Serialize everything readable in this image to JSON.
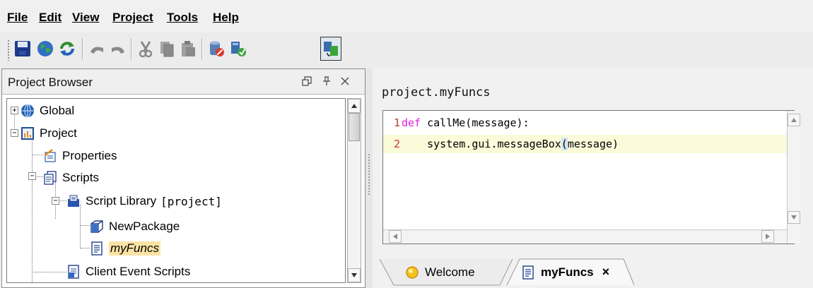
{
  "menubar": {
    "items": [
      {
        "label": "File"
      },
      {
        "label": "Edit"
      },
      {
        "label": "View"
      },
      {
        "label": "Project"
      },
      {
        "label": "Tools"
      },
      {
        "label": "Help"
      }
    ]
  },
  "toolbar": {
    "buttons": [
      "save-icon",
      "globe-icon",
      "refresh-icon",
      "undo-icon",
      "redo-icon",
      "cut-icon",
      "copy-icon",
      "paste-icon",
      "database-icon",
      "gateway-icon",
      "comm-icon"
    ]
  },
  "project_browser": {
    "title": "Project Browser",
    "tree": [
      {
        "label": "Global",
        "icon": "globe-icon"
      },
      {
        "label": "Project",
        "icon": "project-icon"
      },
      {
        "label": "Properties",
        "icon": "properties-icon"
      },
      {
        "label": "Scripts",
        "icon": "scripts-icon"
      },
      {
        "label": "Script Library",
        "suffix": "[project]",
        "icon": "script-library-icon"
      },
      {
        "label": "NewPackage",
        "icon": "package-icon"
      },
      {
        "label": "myFuncs",
        "icon": "script-icon",
        "selected": true
      },
      {
        "label": "Client Event Scripts",
        "icon": "event-scripts-icon"
      }
    ]
  },
  "editor": {
    "path": "project.myFuncs",
    "lines": [
      {
        "num": "1",
        "keyword": "def",
        "rest": " callMe(message):"
      },
      {
        "num": "2",
        "pre": "    system.gui.messageBox",
        "bracket": "(",
        "post": "message)"
      }
    ]
  },
  "tabs": [
    {
      "label": "Welcome",
      "icon": "welcome-icon",
      "active": false
    },
    {
      "label": "myFuncs",
      "icon": "script-icon",
      "active": true,
      "close": "×"
    }
  ],
  "colors": {
    "keyword": "#e020e0",
    "line_number_2": "#c0392b",
    "selection": "#fbe3a5",
    "current_line": "#fbfad9"
  }
}
